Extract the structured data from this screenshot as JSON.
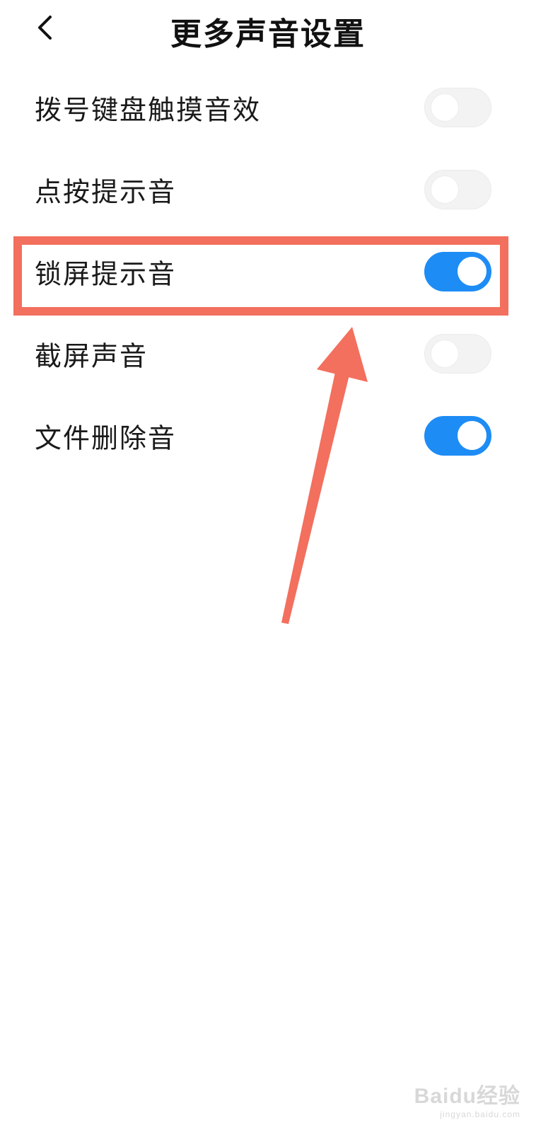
{
  "header": {
    "title": "更多声音设置",
    "back_icon": "chevron-left-icon"
  },
  "settings": [
    {
      "label": "拨号键盘触摸音效",
      "enabled": false
    },
    {
      "label": "点按提示音",
      "enabled": false
    },
    {
      "label": "锁屏提示音",
      "enabled": true
    },
    {
      "label": "截屏声音",
      "enabled": false
    },
    {
      "label": "文件删除音",
      "enabled": true
    }
  ],
  "annotation": {
    "color": "#f36f5e",
    "highlighted_item": "锁屏提示音"
  },
  "colors": {
    "toggle_on": "#1e8cf5",
    "toggle_off": "#f3f3f3"
  },
  "watermark": {
    "brand": "Baidu经验",
    "url": "jingyan.baidu.com"
  }
}
